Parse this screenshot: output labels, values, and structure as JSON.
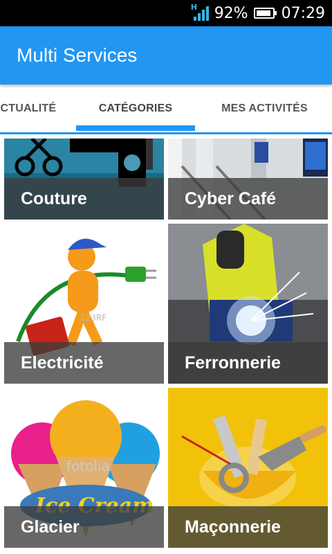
{
  "status_bar": {
    "network_type": "H",
    "battery_percent": "92%",
    "battery_level": 0.92,
    "time": "07:29"
  },
  "app_bar": {
    "title": "Multi Services"
  },
  "tabs": [
    {
      "label": "ACTUALITÉ",
      "selected": false
    },
    {
      "label": "CATÉGORIES",
      "selected": true
    },
    {
      "label": "MES ACTIVITÉS",
      "selected": false
    }
  ],
  "categories": [
    {
      "label": "Couture"
    },
    {
      "label": "Cyber Café"
    },
    {
      "label": "Electricité"
    },
    {
      "label": "Ferronnerie"
    },
    {
      "label": "Glacier"
    },
    {
      "label": "Maçonnerie"
    }
  ],
  "watermarks": {
    "electricite": "123RF",
    "glacier": "fotolia",
    "glacier_logo": "Ice Cream"
  },
  "colors": {
    "primary": "#2196f3",
    "label_band": "#3c3c3c"
  }
}
